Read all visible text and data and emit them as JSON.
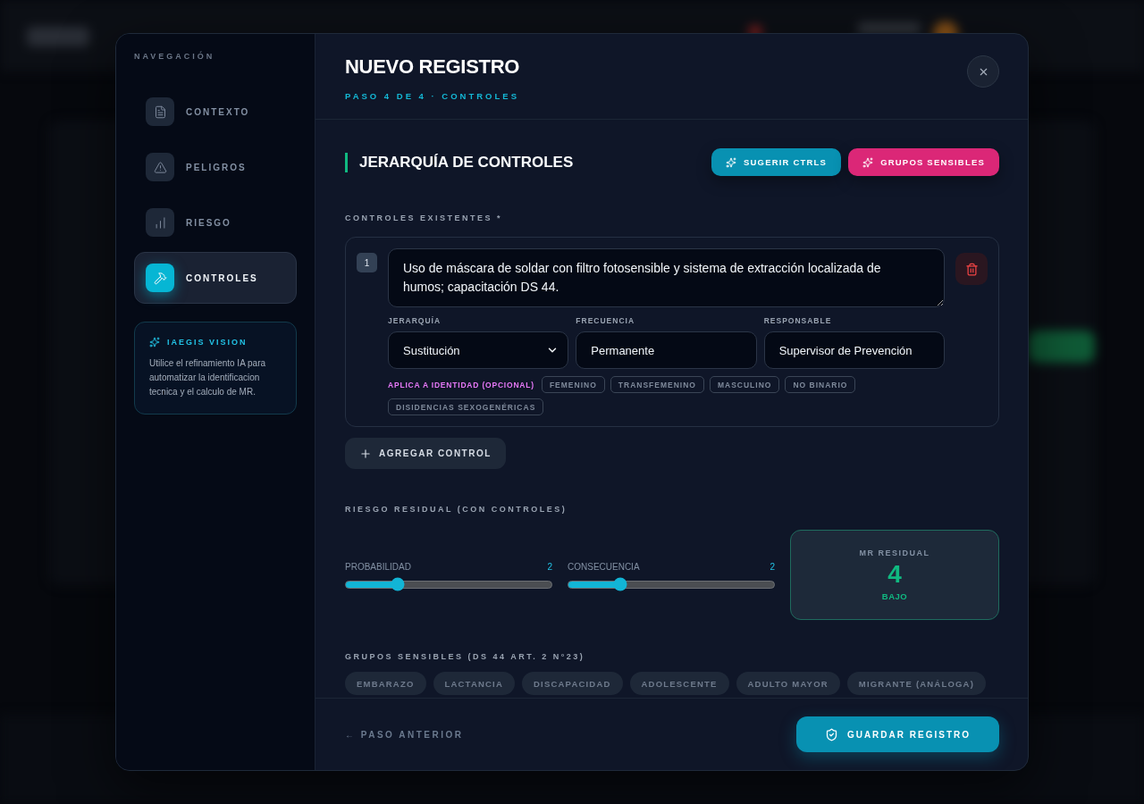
{
  "sidebar": {
    "heading": "NAVEGACIÓN",
    "items": [
      {
        "label": "CONTEXTO",
        "selected": false
      },
      {
        "label": "PELIGROS",
        "selected": false
      },
      {
        "label": "RIESGO",
        "selected": false
      },
      {
        "label": "CONTROLES",
        "selected": true
      }
    ],
    "tip": {
      "title": "IAEGIS VISION",
      "text": "Utilice el refinamiento IA para automatizar la identificacion tecnica y el calculo de MR."
    }
  },
  "header": {
    "title": "NUEVO REGISTRO",
    "step": "PASO 4 DE 4 · CONTROLES"
  },
  "section": {
    "title": "JERARQUÍA DE CONTROLES",
    "actions": [
      {
        "label": "SUGERIR CTRLS",
        "color": "#0891b2"
      },
      {
        "label": "GRUPOS SENSIBLES",
        "color": "#db2777"
      }
    ]
  },
  "controls_label": "CONTROLES EXISTENTES *",
  "controls": [
    {
      "number": "1",
      "description": "Uso de máscara de soldar con filtro fotosensible y sistema de extracción localizada de humos; capacitación DS 44.",
      "fields": [
        {
          "label": "JERARQUÍA",
          "kind": "select",
          "value": "Sustitución"
        },
        {
          "label": "FRECUENCIA",
          "kind": "text",
          "value": "Permanente"
        },
        {
          "label": "RESPONSABLE",
          "kind": "text",
          "value": "Supervisor de Prevención"
        }
      ],
      "identity_label": "APLICA A IDENTIDAD (OPCIONAL)",
      "identities": [
        {
          "label": "FEMENINO",
          "selected": false
        },
        {
          "label": "TRANSFEMENINO",
          "selected": false
        },
        {
          "label": "MASCULINO",
          "selected": false
        },
        {
          "label": "NO BINARIO",
          "selected": false
        },
        {
          "label": "DISIDENCIAS SEXOGENÉRICAS",
          "selected": false
        }
      ]
    }
  ],
  "add_button": "AGREGAR CONTROL",
  "residual": {
    "label": "RIESGO RESIDUAL (CON CONTROLES)",
    "sliders": [
      {
        "name": "PROBABILIDAD",
        "reading": "2",
        "level": 0.25
      },
      {
        "name": "CONSECUENCIA",
        "reading": "2",
        "level": 0.25
      }
    ],
    "result": {
      "label": "MR RESIDUAL",
      "value": "4",
      "rating": "BAJO"
    }
  },
  "groups": {
    "label": "GRUPOS SENSIBLES (DS 44 ART. 2 N°23)",
    "items": [
      {
        "label": "EMBARAZO",
        "selected": false
      },
      {
        "label": "LACTANCIA",
        "selected": false
      },
      {
        "label": "DISCAPACIDAD",
        "selected": false
      },
      {
        "label": "ADOLESCENTE",
        "selected": false
      },
      {
        "label": "ADULTO MAYOR",
        "selected": false
      },
      {
        "label": "MIGRANTE (ANÁLOGA)",
        "selected": false
      }
    ]
  },
  "footer": {
    "back": "← PASO ANTERIOR",
    "save": "GUARDAR REGISTRO"
  }
}
